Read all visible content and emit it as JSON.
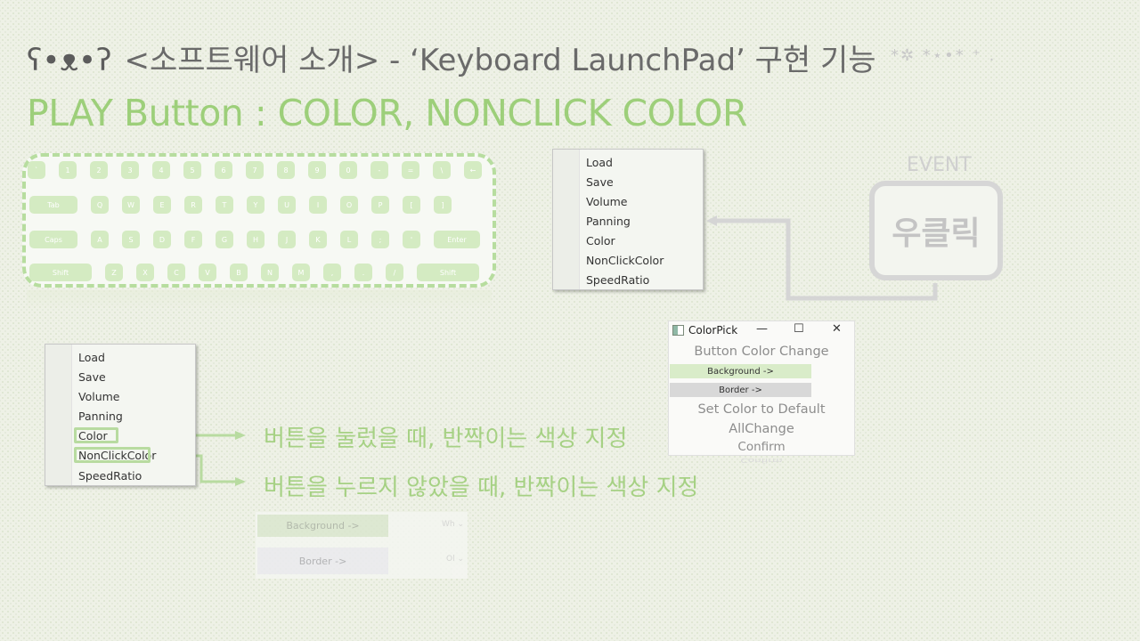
{
  "title": {
    "face": "ʕ•ᴥ•ʔ",
    "text": "<소프트웨어 소개> - ‘Keyboard LaunchPad’ 구현 기능",
    "sparkles": "*✲ *⋆•* ⁺ ."
  },
  "subtitle": "PLAY Button : COLOR, NONCLICK COLOR",
  "keyboard": {
    "row1": [
      "`",
      "1",
      "2",
      "3",
      "4",
      "5",
      "6",
      "7",
      "8",
      "9",
      "0",
      "-",
      "=",
      "\\",
      "←"
    ],
    "row2": [
      "Tab",
      "Q",
      "W",
      "E",
      "R",
      "T",
      "Y",
      "U",
      "I",
      "O",
      "P",
      "[",
      "]"
    ],
    "row3": [
      "Caps",
      "A",
      "S",
      "D",
      "F",
      "G",
      "H",
      "J",
      "K",
      "L",
      ";",
      "'",
      "Enter"
    ],
    "row4": [
      "Shift",
      "Z",
      "X",
      "C",
      "V",
      "B",
      "N",
      "M",
      ",",
      ".",
      "/",
      "Shift"
    ]
  },
  "context_menu": {
    "items": [
      "Load",
      "Save",
      "Volume",
      "Panning",
      "Color",
      "NonClickColor",
      "SpeedRatio"
    ]
  },
  "event": {
    "label": "EVENT",
    "action": "우클릭"
  },
  "colorpick_dialog": {
    "title": "ColorPick",
    "minimize": "—",
    "maximize": "☐",
    "close": "✕",
    "heading": "Button Color Change",
    "background_button": "Background  ->",
    "border_button": "Border  ->",
    "default_link": "Set Color to Default",
    "allchange_link": "AllChange",
    "confirm_button": "Confirm",
    "confirm_shadow": "Confirm"
  },
  "descriptions": {
    "color": "버튼을 눌렀을 때, 반짝이는 색상 지정",
    "nonclick": "버튼을 누르지 않았을 때, 반짝이는 색상 지정"
  },
  "ghost_panel": {
    "background": "Background  ->",
    "border": "Border  ->",
    "select1": "Wh",
    "select2": "Ol"
  },
  "colors": {
    "accent_green": "#9dcf7a",
    "key_green": "#d4ebc2",
    "title_gray": "#6a6a6a"
  }
}
